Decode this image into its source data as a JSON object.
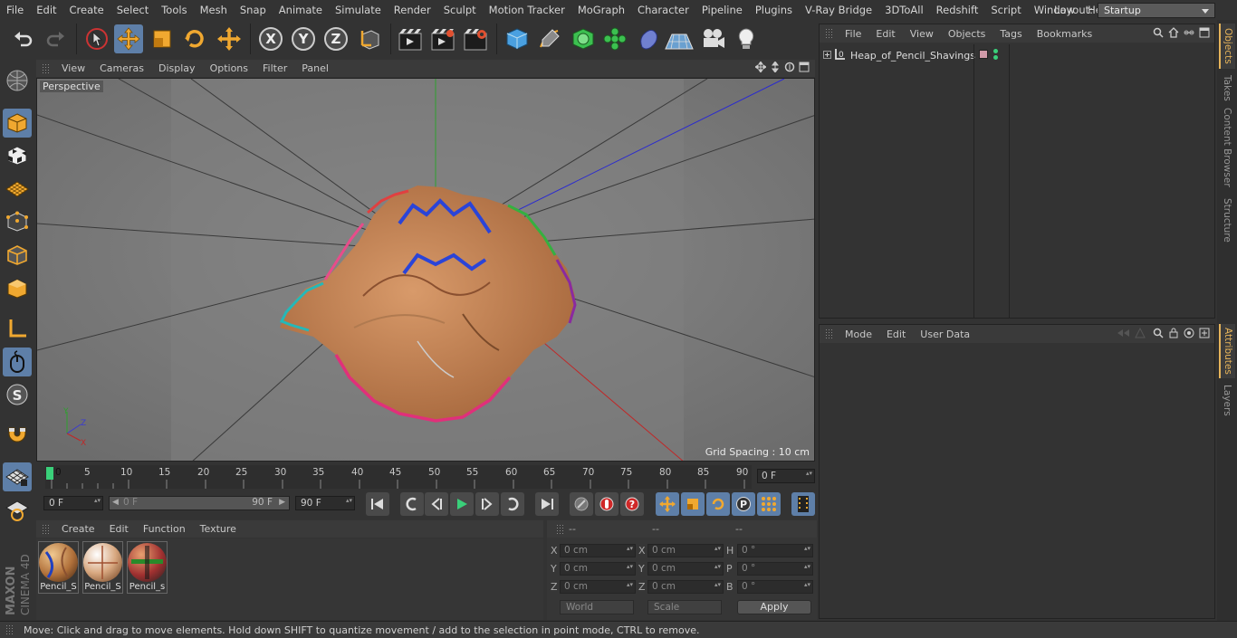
{
  "menubar": {
    "items": [
      "File",
      "Edit",
      "Create",
      "Select",
      "Tools",
      "Mesh",
      "Snap",
      "Animate",
      "Simulate",
      "Render",
      "Sculpt",
      "Motion Tracker",
      "MoGraph",
      "Character",
      "Pipeline",
      "Plugins",
      "V-Ray Bridge",
      "3DToAll",
      "Redshift",
      "Script",
      "Window",
      "Help"
    ],
    "layout_label": "Layout:",
    "layout_value": "Startup"
  },
  "toolbar": {
    "icons": [
      "undo-icon",
      "redo-icon",
      "live-selection-icon",
      "move-icon",
      "scale-icon",
      "rotate-icon",
      "recent-tool-icon",
      "x-axis-icon",
      "y-axis-icon",
      "z-axis-icon",
      "coordinate-system-icon",
      "render-view-icon",
      "render-picture-viewer-icon",
      "render-settings-icon",
      "cube-primitive-icon",
      "pen-spline-icon",
      "subdivision-nurbs-icon",
      "cloner-icon",
      "deformer-icon",
      "floor-environment-icon",
      "camera-icon",
      "light-icon"
    ]
  },
  "viewport": {
    "menu": [
      "View",
      "Cameras",
      "Display",
      "Options",
      "Filter",
      "Panel"
    ],
    "camera_label": "Perspective",
    "grid_spacing": "Grid Spacing : 10 cm"
  },
  "timeline": {
    "ticks": [
      "0",
      "5",
      "10",
      "15",
      "20",
      "25",
      "30",
      "35",
      "40",
      "45",
      "50",
      "55",
      "60",
      "65",
      "70",
      "75",
      "80",
      "85",
      "90"
    ],
    "current_frame": "0 F",
    "start_field": "0 F",
    "range_start": "0 F",
    "range_end": "90 F",
    "end_field": "90 F"
  },
  "materials": {
    "menu": [
      "Create",
      "Edit",
      "Function",
      "Texture"
    ],
    "items": [
      {
        "label": "Pencil_S"
      },
      {
        "label": "Pencil_S"
      },
      {
        "label": "Pencil_s"
      }
    ]
  },
  "coordinates": {
    "headers": [
      "--",
      "--",
      "--"
    ],
    "rows": [
      {
        "a": "X",
        "av": "0 cm",
        "b": "X",
        "bv": "0 cm",
        "c": "H",
        "cv": "0 °"
      },
      {
        "a": "Y",
        "av": "0 cm",
        "b": "Y",
        "bv": "0 cm",
        "c": "P",
        "cv": "0 °"
      },
      {
        "a": "Z",
        "av": "0 cm",
        "b": "Z",
        "bv": "0 cm",
        "c": "B",
        "cv": "0 °"
      }
    ],
    "world": "World",
    "scale": "Scale",
    "apply": "Apply"
  },
  "objects": {
    "menu": [
      "File",
      "Edit",
      "View",
      "Objects",
      "Tags",
      "Bookmarks"
    ],
    "items": [
      {
        "name": "Heap_of_Pencil_Shavings"
      }
    ]
  },
  "attributes": {
    "menu": [
      "Mode",
      "Edit",
      "User Data"
    ]
  },
  "side_tabs_top": [
    "Objects",
    "Takes",
    "Content Browser",
    "Structure"
  ],
  "side_tabs_bottom": [
    "Attributes",
    "Layers"
  ],
  "status": "Move: Click and drag to move elements. Hold down SHIFT to quantize movement / add to the selection in point mode, CTRL to remove.",
  "brand": {
    "maxon": "MAXON",
    "product": "CINEMA 4D"
  },
  "colors": {
    "accent": "#5e7fa8",
    "tab_active": "#e6b45a",
    "shaving_wood": "#c8895e"
  }
}
